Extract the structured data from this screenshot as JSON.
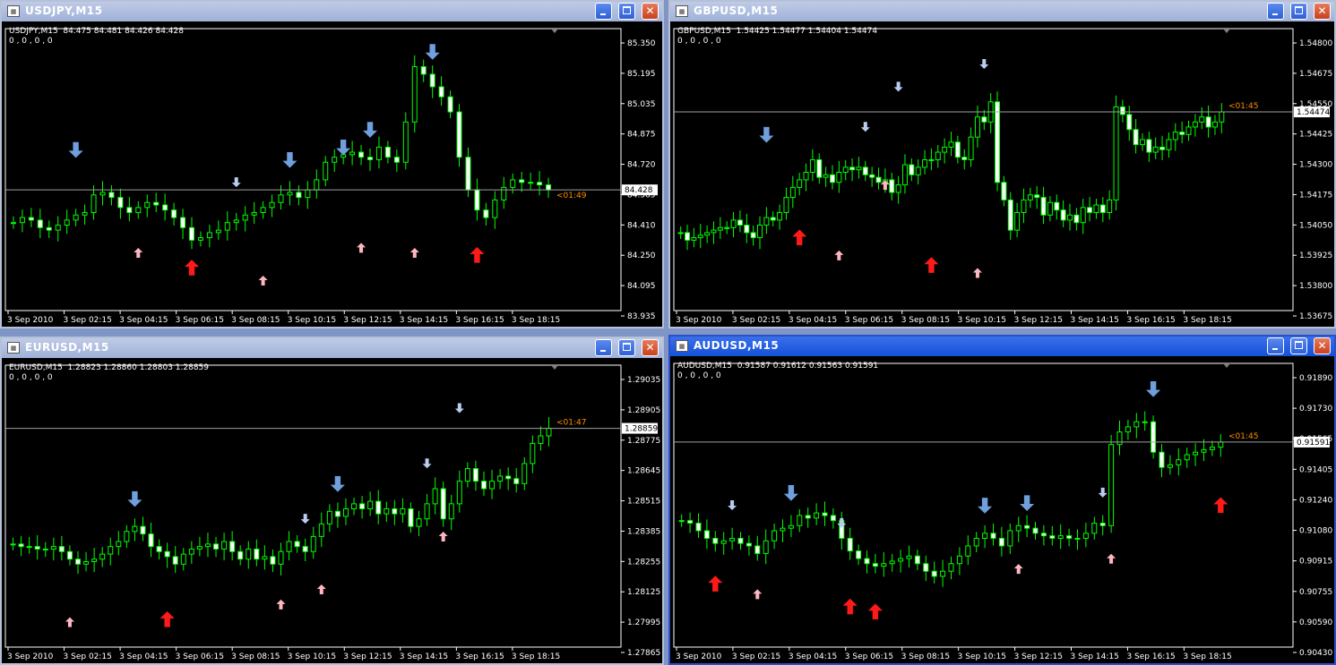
{
  "windows": [
    {
      "id": "usdjpy",
      "title": "USDJPY,M15",
      "header": "USDJPY,M15  84.475 84.481 84.426 84.428",
      "indicator": "0 , 0 , 0 , 0",
      "active": false,
      "prices": [
        "85.350",
        "85.195",
        "85.035",
        "84.875",
        "84.720",
        "84.565",
        "84.410",
        "84.250",
        "84.095",
        "83.935"
      ],
      "last_price": "84.428",
      "timer": "<01:49",
      "times": [
        "3 Sep 2010",
        "3 Sep 02:15",
        "3 Sep 04:15",
        "3 Sep 06:15",
        "3 Sep 08:15",
        "3 Sep 10:15",
        "3 Sep 12:15",
        "3 Sep 14:15",
        "3 Sep 16:15",
        "3 Sep 18:15"
      ],
      "close_path": [
        0.3,
        0.32,
        0.31,
        0.28,
        0.27,
        0.29,
        0.31,
        0.33,
        0.34,
        0.41,
        0.42,
        0.4,
        0.36,
        0.34,
        0.36,
        0.38,
        0.37,
        0.35,
        0.32,
        0.28,
        0.23,
        0.24,
        0.26,
        0.27,
        0.3,
        0.31,
        0.33,
        0.34,
        0.36,
        0.38,
        0.41,
        0.42,
        0.4,
        0.43,
        0.47,
        0.54,
        0.56,
        0.57,
        0.58,
        0.56,
        0.55,
        0.6,
        0.56,
        0.54,
        0.7,
        0.92,
        0.89,
        0.84,
        0.8,
        0.74,
        0.56,
        0.43,
        0.35,
        0.32,
        0.39,
        0.44,
        0.47,
        0.46,
        0.46,
        0.45,
        0.43
      ],
      "markers": [
        {
          "i": 7,
          "dir": "down",
          "size": "big",
          "color": "#6f9fdc",
          "v": 0.62
        },
        {
          "i": 14,
          "dir": "up",
          "size": "small",
          "color": "#ffb6c1",
          "v": 0.16
        },
        {
          "i": 20,
          "dir": "up",
          "size": "big",
          "color": "#ff1a1a",
          "v": 0.09
        },
        {
          "i": 25,
          "dir": "down",
          "size": "small",
          "color": "#b9cdf0",
          "v": 0.48
        },
        {
          "i": 28,
          "dir": "up",
          "size": "small",
          "color": "#ffb6c1",
          "v": 0.05
        },
        {
          "i": 31,
          "dir": "down",
          "size": "big",
          "color": "#6f9fdc",
          "v": 0.58
        },
        {
          "i": 37,
          "dir": "down",
          "size": "big",
          "color": "#6f9fdc",
          "v": 0.63
        },
        {
          "i": 39,
          "dir": "up",
          "size": "small",
          "color": "#ffb6c1",
          "v": 0.18
        },
        {
          "i": 40,
          "dir": "down",
          "size": "big",
          "color": "#6f9fdc",
          "v": 0.7
        },
        {
          "i": 45,
          "dir": "up",
          "size": "small",
          "color": "#ffb6c1",
          "v": 0.16
        },
        {
          "i": 47,
          "dir": "down",
          "size": "big",
          "color": "#6f9fdc",
          "v": 1.01
        },
        {
          "i": 52,
          "dir": "up",
          "size": "big",
          "color": "#ff1a1a",
          "v": 0.14
        }
      ]
    },
    {
      "id": "gbpusd",
      "title": "GBPUSD,M15",
      "header": "GBPUSD,M15  1.54425 1.54477 1.54404 1.54474",
      "indicator": "0 , 0 , 0 , 0",
      "active": false,
      "prices": [
        "1.54800",
        "1.54675",
        "1.54550",
        "1.54425",
        "1.54300",
        "1.54175",
        "1.54050",
        "1.53925",
        "1.53800",
        "1.53675"
      ],
      "last_price": "1.54474",
      "timer": "<01:45",
      "times": [
        "3 Sep 2010",
        "3 Sep 02:15",
        "3 Sep 04:15",
        "3 Sep 06:15",
        "3 Sep 08:15",
        "3 Sep 10:15",
        "3 Sep 12:15",
        "3 Sep 14:15",
        "3 Sep 16:15",
        "3 Sep 18:15"
      ],
      "close_path": [
        0.26,
        0.23,
        0.24,
        0.25,
        0.26,
        0.27,
        0.28,
        0.28,
        0.31,
        0.29,
        0.26,
        0.24,
        0.29,
        0.32,
        0.31,
        0.34,
        0.4,
        0.44,
        0.47,
        0.5,
        0.55,
        0.48,
        0.49,
        0.46,
        0.5,
        0.52,
        0.51,
        0.52,
        0.49,
        0.48,
        0.46,
        0.47,
        0.42,
        0.45,
        0.53,
        0.49,
        0.52,
        0.55,
        0.55,
        0.58,
        0.6,
        0.62,
        0.56,
        0.55,
        0.64,
        0.72,
        0.7,
        0.78,
        0.46,
        0.39,
        0.27,
        0.34,
        0.39,
        0.41,
        0.4,
        0.33,
        0.38,
        0.35,
        0.31,
        0.33,
        0.3,
        0.36,
        0.34,
        0.37,
        0.34,
        0.39,
        0.76,
        0.73,
        0.67,
        0.61,
        0.63,
        0.58,
        0.6,
        0.59,
        0.63,
        0.66,
        0.65,
        0.68,
        0.7,
        0.72,
        0.68,
        0.7,
        0.74
      ],
      "markers": [
        {
          "i": 13,
          "dir": "down",
          "size": "big",
          "color": "#6f9fdc",
          "v": 0.68
        },
        {
          "i": 18,
          "dir": "up",
          "size": "big",
          "color": "#ff1a1a",
          "v": 0.21
        },
        {
          "i": 24,
          "dir": "up",
          "size": "small",
          "color": "#ffb6c1",
          "v": 0.15
        },
        {
          "i": 28,
          "dir": "down",
          "size": "small",
          "color": "#b9cdf0",
          "v": 0.7
        },
        {
          "i": 31,
          "dir": "up",
          "size": "small",
          "color": "#ffb6c1",
          "v": 0.43
        },
        {
          "i": 33,
          "dir": "down",
          "size": "small",
          "color": "#b9cdf0",
          "v": 0.86
        },
        {
          "i": 38,
          "dir": "up",
          "size": "big",
          "color": "#ff1a1a",
          "v": 0.1
        },
        {
          "i": 45,
          "dir": "up",
          "size": "small",
          "color": "#ffb6c1",
          "v": 0.08
        },
        {
          "i": 46,
          "dir": "down",
          "size": "small",
          "color": "#b9cdf0",
          "v": 0.95
        }
      ]
    },
    {
      "id": "eurusd",
      "title": "EURUSD,M15",
      "header": "EURUSD,M15  1.28823 1.28860 1.28803 1.28859",
      "indicator": "0 , 0 , 0 , 0",
      "active": false,
      "prices": [
        "1.29035",
        "1.28905",
        "1.28775",
        "1.28645",
        "1.28515",
        "1.28385",
        "1.28255",
        "1.28125",
        "1.27995",
        "1.27865"
      ],
      "last_price": "1.28859",
      "timer": "<01:47",
      "times": [
        "3 Sep 2010",
        "3 Sep 02:15",
        "3 Sep 04:15",
        "3 Sep 06:15",
        "3 Sep 08:15",
        "3 Sep 10:15",
        "3 Sep 12:15",
        "3 Sep 14:15",
        "3 Sep 16:15",
        "3 Sep 18:15"
      ],
      "close_path": [
        0.36,
        0.35,
        0.35,
        0.34,
        0.34,
        0.35,
        0.33,
        0.3,
        0.28,
        0.29,
        0.3,
        0.32,
        0.35,
        0.37,
        0.41,
        0.43,
        0.4,
        0.35,
        0.33,
        0.31,
        0.28,
        0.32,
        0.34,
        0.35,
        0.36,
        0.34,
        0.37,
        0.33,
        0.3,
        0.34,
        0.3,
        0.31,
        0.28,
        0.33,
        0.37,
        0.35,
        0.33,
        0.39,
        0.44,
        0.49,
        0.47,
        0.5,
        0.52,
        0.5,
        0.53,
        0.48,
        0.5,
        0.48,
        0.5,
        0.43,
        0.46,
        0.52,
        0.58,
        0.46,
        0.52,
        0.61,
        0.66,
        0.61,
        0.58,
        0.61,
        0.63,
        0.62,
        0.6,
        0.68,
        0.76,
        0.79,
        0.82
      ],
      "markers": [
        {
          "i": 7,
          "dir": "up",
          "size": "small",
          "color": "#ffb6c1",
          "v": 0.03
        },
        {
          "i": 15,
          "dir": "down",
          "size": "big",
          "color": "#6f9fdc",
          "v": 0.57
        },
        {
          "i": 19,
          "dir": "up",
          "size": "big",
          "color": "#ff1a1a",
          "v": 0.03
        },
        {
          "i": 33,
          "dir": "up",
          "size": "small",
          "color": "#ffb6c1",
          "v": 0.1
        },
        {
          "i": 36,
          "dir": "down",
          "size": "small",
          "color": "#b9cdf0",
          "v": 0.48
        },
        {
          "i": 38,
          "dir": "up",
          "size": "small",
          "color": "#ffb6c1",
          "v": 0.16
        },
        {
          "i": 40,
          "dir": "down",
          "size": "big",
          "color": "#6f9fdc",
          "v": 0.63
        },
        {
          "i": 51,
          "dir": "down",
          "size": "small",
          "color": "#b9cdf0",
          "v": 0.7
        },
        {
          "i": 53,
          "dir": "up",
          "size": "small",
          "color": "#ffb6c1",
          "v": 0.37
        },
        {
          "i": 55,
          "dir": "down",
          "size": "small",
          "color": "#b9cdf0",
          "v": 0.92
        }
      ]
    },
    {
      "id": "audusd",
      "title": "AUDUSD,M15",
      "header": "AUDUSD,M15  0.91587 0.91612 0.91563 0.91591",
      "indicator": "0 , 0 , 0 , 0",
      "active": true,
      "prices": [
        "0.91890",
        "0.91730",
        "0.91565",
        "0.91405",
        "0.91240",
        "0.91080",
        "0.90915",
        "0.90755",
        "0.90590",
        "0.90430"
      ],
      "last_price": "0.91591",
      "timer": "<01:45",
      "times": [
        "3 Sep 2010",
        "3 Sep 02:15",
        "3 Sep 04:15",
        "3 Sep 06:15",
        "3 Sep 08:15",
        "3 Sep 10:15",
        "3 Sep 12:15",
        "3 Sep 14:15",
        "3 Sep 16:15",
        "3 Sep 18:15"
      ],
      "close_path": [
        0.45,
        0.44,
        0.41,
        0.38,
        0.36,
        0.37,
        0.38,
        0.36,
        0.35,
        0.32,
        0.37,
        0.41,
        0.42,
        0.43,
        0.47,
        0.46,
        0.48,
        0.47,
        0.45,
        0.38,
        0.33,
        0.3,
        0.28,
        0.27,
        0.28,
        0.29,
        0.3,
        0.31,
        0.28,
        0.25,
        0.23,
        0.25,
        0.28,
        0.31,
        0.35,
        0.38,
        0.4,
        0.38,
        0.35,
        0.41,
        0.43,
        0.42,
        0.4,
        0.39,
        0.38,
        0.39,
        0.38,
        0.38,
        0.4,
        0.44,
        0.43,
        0.75,
        0.8,
        0.82,
        0.84,
        0.84,
        0.72,
        0.66,
        0.67,
        0.69,
        0.71,
        0.72,
        0.73,
        0.74,
        0.76
      ],
      "markers": [
        {
          "i": 4,
          "dir": "up",
          "size": "big",
          "color": "#ff1a1a",
          "v": 0.17
        },
        {
          "i": 6,
          "dir": "down",
          "size": "small",
          "color": "#b9cdf0",
          "v": 0.53
        },
        {
          "i": 9,
          "dir": "up",
          "size": "small",
          "color": "#ffb6c1",
          "v": 0.14
        },
        {
          "i": 13,
          "dir": "down",
          "size": "big",
          "color": "#6f9fdc",
          "v": 0.59
        },
        {
          "i": 19,
          "dir": "down",
          "size": "small",
          "color": "#b9cdf0",
          "v": 0.46
        },
        {
          "i": 20,
          "dir": "up",
          "size": "big",
          "color": "#ff1a1a",
          "v": 0.08
        },
        {
          "i": 23,
          "dir": "up",
          "size": "big",
          "color": "#ff1a1a",
          "v": 0.06
        },
        {
          "i": 36,
          "dir": "down",
          "size": "big",
          "color": "#6f9fdc",
          "v": 0.54
        },
        {
          "i": 40,
          "dir": "up",
          "size": "small",
          "color": "#ffb6c1",
          "v": 0.24
        },
        {
          "i": 41,
          "dir": "down",
          "size": "big",
          "color": "#6f9fdc",
          "v": 0.55
        },
        {
          "i": 50,
          "dir": "down",
          "size": "small",
          "color": "#b9cdf0",
          "v": 0.58
        },
        {
          "i": 51,
          "dir": "up",
          "size": "small",
          "color": "#ffb6c1",
          "v": 0.28
        },
        {
          "i": 56,
          "dir": "down",
          "size": "big",
          "color": "#6f9fdc",
          "v": 1.0
        },
        {
          "i": 64,
          "dir": "up",
          "size": "big",
          "color": "#ff1a1a",
          "v": 0.48
        }
      ]
    }
  ],
  "colors": {
    "candle": "#00ff00",
    "candle_up_fill": "#000000",
    "candle_down_fill": "#ffffff",
    "timer": "#ff8c00",
    "bid_line": "#a0a0a0"
  }
}
